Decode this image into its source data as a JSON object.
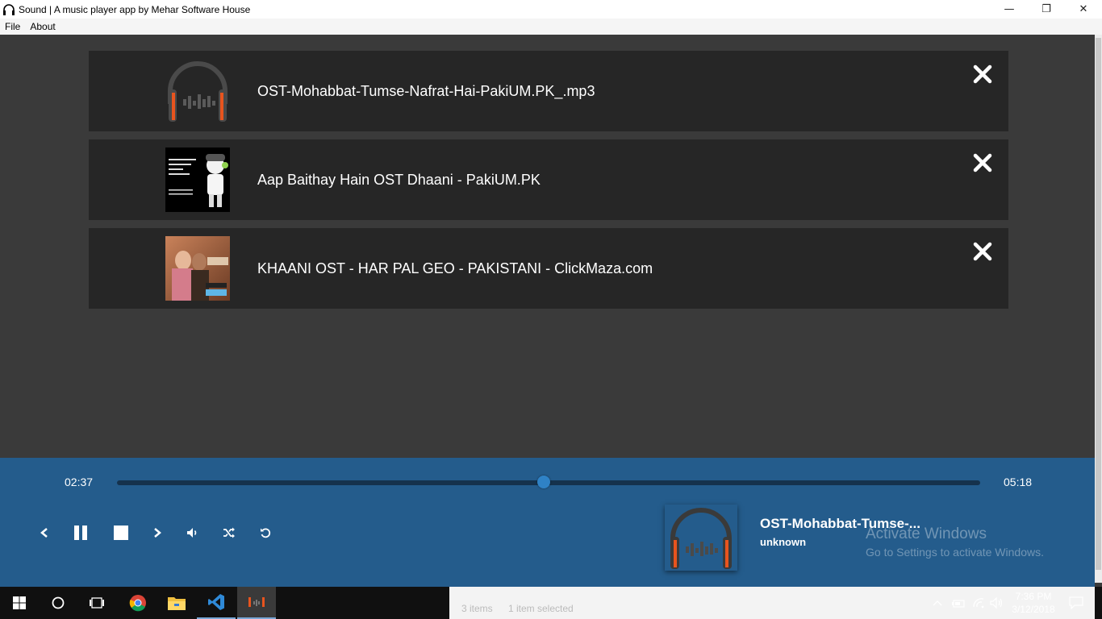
{
  "window": {
    "title": "Sound | A music player app by Mehar Software House",
    "minimize_glyph": "—",
    "restore_glyph": "❐",
    "close_glyph": "✕"
  },
  "menu": {
    "items": [
      {
        "label": "File"
      },
      {
        "label": "About"
      }
    ]
  },
  "playlist": {
    "tracks": [
      {
        "name": "OST-Mohabbat-Tumse-Nafrat-Hai-PakiUM.PK_.mp3",
        "art": "headphones-default-icon"
      },
      {
        "name": "Aap Baithay Hain OST Dhaani - PakiUM.PK",
        "art": "pakium-cover-art"
      },
      {
        "name": "KHAANI OST - HAR PAL GEO - PAKISTANI - ClickMaza.com",
        "art": "khaani-cover-art"
      }
    ]
  },
  "player": {
    "current_time": "02:37",
    "total_time": "05:18",
    "progress_fraction": 0.494,
    "now_playing_title": "OST-Mohabbat-Tumse-...",
    "now_playing_artist": "unknown",
    "controls": [
      "previous-icon",
      "pause-icon",
      "stop-icon",
      "next-icon",
      "volume-icon",
      "shuffle-icon",
      "repeat-icon"
    ]
  },
  "watermark": {
    "line1": "Activate Windows",
    "line2": "Go to Settings to activate Windows."
  },
  "taskbar": {
    "explorer_items": "3 items",
    "explorer_selected": "1 item selected",
    "time": "7:36 PM",
    "date": "3/12/2018"
  },
  "colors": {
    "player_bg": "#245c8c",
    "track_bg": "#262626",
    "accent_orange": "#e8541e"
  }
}
